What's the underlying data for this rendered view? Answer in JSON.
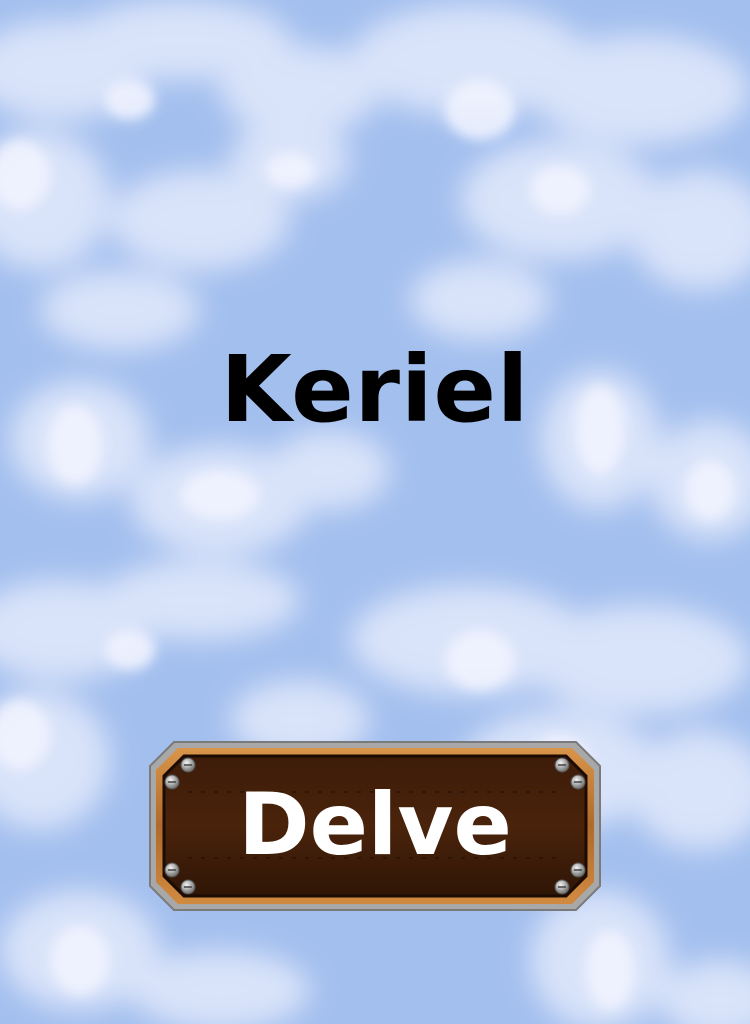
{
  "title": "Keriel",
  "primary_button": {
    "label": "Delve",
    "icon": "riveted-wooden-plank"
  },
  "background": {
    "type": "cloudy-sky",
    "color": "#a3bfee"
  },
  "colors": {
    "title_text": "#000000",
    "button_text": "#ffffff",
    "button_wood": "#3a1a08",
    "button_frame": "#c07a34",
    "button_border": "#9a9a9a"
  }
}
